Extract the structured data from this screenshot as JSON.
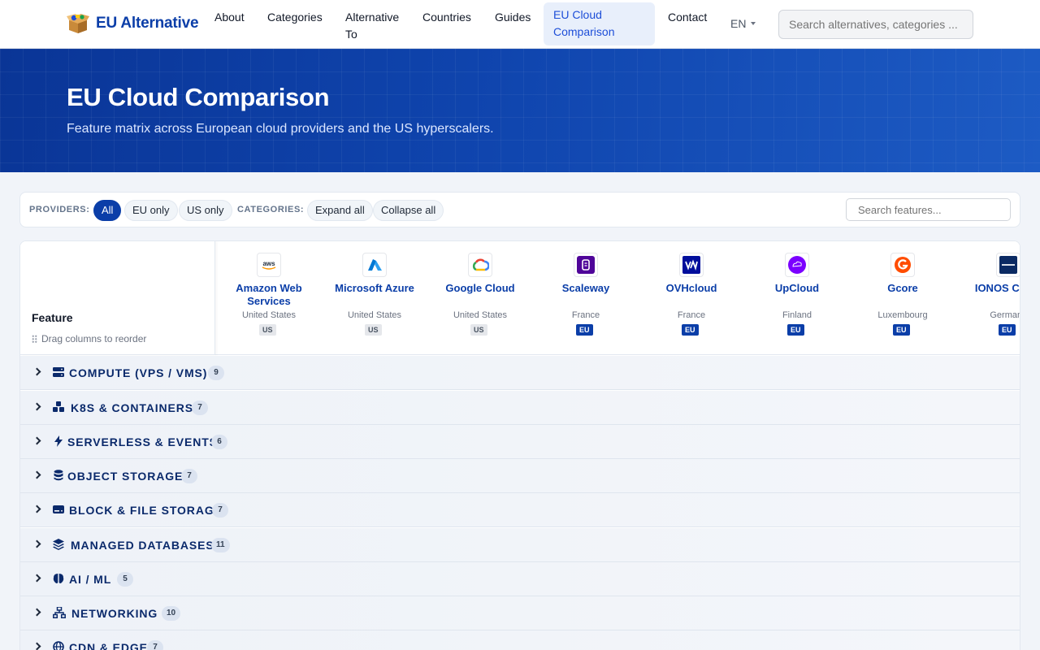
{
  "brand": {
    "name": "EU Alternative"
  },
  "nav": {
    "links": [
      "About",
      "Categories",
      "Alternative To",
      "Countries",
      "Guides",
      "EU Cloud Comparison",
      "Contact"
    ],
    "lang": "EN",
    "search_placeholder": "Search alternatives, categories ..."
  },
  "hero": {
    "title": "EU Cloud Comparison",
    "subtitle": "Feature matrix across European cloud providers and the US hyperscalers."
  },
  "toolbar": {
    "providers_label": "PROVIDERS:",
    "provider_filters": [
      "All",
      "EU only",
      "US only"
    ],
    "active_filter": "All",
    "categories_label": "CATEGORIES:",
    "expand_all": "Expand all",
    "collapse_all": "Collapse all",
    "feature_search_placeholder": "Search features..."
  },
  "table": {
    "feature_header": "Feature",
    "drag_hint": "Drag columns to reorder",
    "providers": [
      {
        "name": "Amazon Web Services",
        "country": "United States",
        "region": "US",
        "logo": "aws-logo"
      },
      {
        "name": "Microsoft Azure",
        "country": "United States",
        "region": "US",
        "logo": "azure-logo"
      },
      {
        "name": "Google Cloud",
        "country": "United States",
        "region": "US",
        "logo": "google-cloud-logo"
      },
      {
        "name": "Scaleway",
        "country": "France",
        "region": "EU",
        "logo": "scaleway-logo"
      },
      {
        "name": "OVHcloud",
        "country": "France",
        "region": "EU",
        "logo": "ovhcloud-logo"
      },
      {
        "name": "UpCloud",
        "country": "Finland",
        "region": "EU",
        "logo": "upcloud-logo"
      },
      {
        "name": "Gcore",
        "country": "Luxembourg",
        "region": "EU",
        "logo": "gcore-logo"
      },
      {
        "name": "IONOS Cloud",
        "country": "Germany",
        "region": "EU",
        "logo": "ionos-logo"
      }
    ],
    "categories": [
      {
        "name": "COMPUTE (VPS / VMS)",
        "count": "9",
        "icon": "server-icon"
      },
      {
        "name": "K8S & CONTAINERS",
        "count": "7",
        "icon": "cubes-icon"
      },
      {
        "name": "SERVERLESS & EVENTS",
        "count": "6",
        "icon": "bolt-icon"
      },
      {
        "name": "OBJECT STORAGE",
        "count": "7",
        "icon": "database-icon"
      },
      {
        "name": "BLOCK & FILE STORAGE",
        "count": "7",
        "icon": "hdd-icon"
      },
      {
        "name": "MANAGED DATABASES",
        "count": "11",
        "icon": "layers-icon"
      },
      {
        "name": "AI / ML",
        "count": "5",
        "icon": "brain-icon"
      },
      {
        "name": "NETWORKING",
        "count": "10",
        "icon": "network-icon"
      },
      {
        "name": "CDN & EDGE",
        "count": "7",
        "icon": "globe-icon"
      }
    ]
  },
  "colors": {
    "accent": "#0b3ea8",
    "hero_start": "#0a3596",
    "hero_end": "#1d5bc4"
  }
}
